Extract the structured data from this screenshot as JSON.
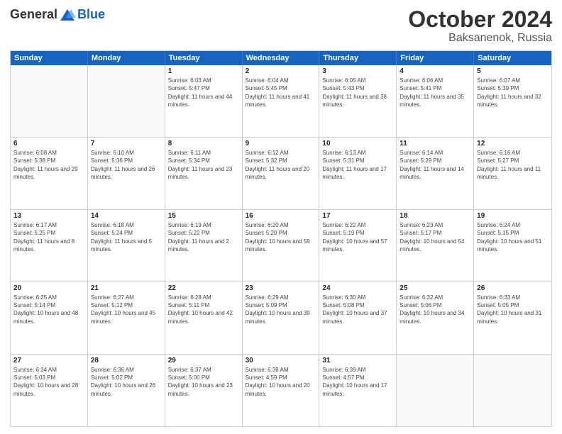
{
  "header": {
    "logo": {
      "general": "General",
      "blue": "Blue"
    },
    "month": "October 2024",
    "location": "Baksanenok, Russia"
  },
  "weekdays": [
    "Sunday",
    "Monday",
    "Tuesday",
    "Wednesday",
    "Thursday",
    "Friday",
    "Saturday"
  ],
  "rows": [
    [
      {
        "day": "",
        "sunrise": "",
        "sunset": "",
        "daylight": "",
        "empty": true
      },
      {
        "day": "",
        "sunrise": "",
        "sunset": "",
        "daylight": "",
        "empty": true
      },
      {
        "day": "1",
        "sunrise": "Sunrise: 6:03 AM",
        "sunset": "Sunset: 5:47 PM",
        "daylight": "Daylight: 11 hours and 44 minutes."
      },
      {
        "day": "2",
        "sunrise": "Sunrise: 6:04 AM",
        "sunset": "Sunset: 5:45 PM",
        "daylight": "Daylight: 11 hours and 41 minutes."
      },
      {
        "day": "3",
        "sunrise": "Sunrise: 6:05 AM",
        "sunset": "Sunset: 5:43 PM",
        "daylight": "Daylight: 11 hours and 38 minutes."
      },
      {
        "day": "4",
        "sunrise": "Sunrise: 6:06 AM",
        "sunset": "Sunset: 5:41 PM",
        "daylight": "Daylight: 11 hours and 35 minutes."
      },
      {
        "day": "5",
        "sunrise": "Sunrise: 6:07 AM",
        "sunset": "Sunset: 5:39 PM",
        "daylight": "Daylight: 11 hours and 32 minutes."
      }
    ],
    [
      {
        "day": "6",
        "sunrise": "Sunrise: 6:08 AM",
        "sunset": "Sunset: 5:38 PM",
        "daylight": "Daylight: 11 hours and 29 minutes."
      },
      {
        "day": "7",
        "sunrise": "Sunrise: 6:10 AM",
        "sunset": "Sunset: 5:36 PM",
        "daylight": "Daylight: 11 hours and 26 minutes."
      },
      {
        "day": "8",
        "sunrise": "Sunrise: 6:11 AM",
        "sunset": "Sunset: 5:34 PM",
        "daylight": "Daylight: 11 hours and 23 minutes."
      },
      {
        "day": "9",
        "sunrise": "Sunrise: 6:12 AM",
        "sunset": "Sunset: 5:32 PM",
        "daylight": "Daylight: 11 hours and 20 minutes."
      },
      {
        "day": "10",
        "sunrise": "Sunrise: 6:13 AM",
        "sunset": "Sunset: 5:31 PM",
        "daylight": "Daylight: 11 hours and 17 minutes."
      },
      {
        "day": "11",
        "sunrise": "Sunrise: 6:14 AM",
        "sunset": "Sunset: 5:29 PM",
        "daylight": "Daylight: 11 hours and 14 minutes."
      },
      {
        "day": "12",
        "sunrise": "Sunrise: 6:16 AM",
        "sunset": "Sunset: 5:27 PM",
        "daylight": "Daylight: 11 hours and 11 minutes."
      }
    ],
    [
      {
        "day": "13",
        "sunrise": "Sunrise: 6:17 AM",
        "sunset": "Sunset: 5:25 PM",
        "daylight": "Daylight: 11 hours and 8 minutes."
      },
      {
        "day": "14",
        "sunrise": "Sunrise: 6:18 AM",
        "sunset": "Sunset: 5:24 PM",
        "daylight": "Daylight: 11 hours and 5 minutes."
      },
      {
        "day": "15",
        "sunrise": "Sunrise: 6:19 AM",
        "sunset": "Sunset: 5:22 PM",
        "daylight": "Daylight: 11 hours and 2 minutes."
      },
      {
        "day": "16",
        "sunrise": "Sunrise: 6:20 AM",
        "sunset": "Sunset: 5:20 PM",
        "daylight": "Daylight: 10 hours and 59 minutes."
      },
      {
        "day": "17",
        "sunrise": "Sunrise: 6:22 AM",
        "sunset": "Sunset: 5:19 PM",
        "daylight": "Daylight: 10 hours and 57 minutes."
      },
      {
        "day": "18",
        "sunrise": "Sunrise: 6:23 AM",
        "sunset": "Sunset: 5:17 PM",
        "daylight": "Daylight: 10 hours and 54 minutes."
      },
      {
        "day": "19",
        "sunrise": "Sunrise: 6:24 AM",
        "sunset": "Sunset: 5:15 PM",
        "daylight": "Daylight: 10 hours and 51 minutes."
      }
    ],
    [
      {
        "day": "20",
        "sunrise": "Sunrise: 6:25 AM",
        "sunset": "Sunset: 5:14 PM",
        "daylight": "Daylight: 10 hours and 48 minutes."
      },
      {
        "day": "21",
        "sunrise": "Sunrise: 6:27 AM",
        "sunset": "Sunset: 5:12 PM",
        "daylight": "Daylight: 10 hours and 45 minutes."
      },
      {
        "day": "22",
        "sunrise": "Sunrise: 6:28 AM",
        "sunset": "Sunset: 5:11 PM",
        "daylight": "Daylight: 10 hours and 42 minutes."
      },
      {
        "day": "23",
        "sunrise": "Sunrise: 6:29 AM",
        "sunset": "Sunset: 5:09 PM",
        "daylight": "Daylight: 10 hours and 39 minutes."
      },
      {
        "day": "24",
        "sunrise": "Sunrise: 6:30 AM",
        "sunset": "Sunset: 5:08 PM",
        "daylight": "Daylight: 10 hours and 37 minutes."
      },
      {
        "day": "25",
        "sunrise": "Sunrise: 6:32 AM",
        "sunset": "Sunset: 5:06 PM",
        "daylight": "Daylight: 10 hours and 34 minutes."
      },
      {
        "day": "26",
        "sunrise": "Sunrise: 6:33 AM",
        "sunset": "Sunset: 5:05 PM",
        "daylight": "Daylight: 10 hours and 31 minutes."
      }
    ],
    [
      {
        "day": "27",
        "sunrise": "Sunrise: 6:34 AM",
        "sunset": "Sunset: 5:03 PM",
        "daylight": "Daylight: 10 hours and 28 minutes."
      },
      {
        "day": "28",
        "sunrise": "Sunrise: 6:36 AM",
        "sunset": "Sunset: 5:02 PM",
        "daylight": "Daylight: 10 hours and 26 minutes."
      },
      {
        "day": "29",
        "sunrise": "Sunrise: 6:37 AM",
        "sunset": "Sunset: 5:00 PM",
        "daylight": "Daylight: 10 hours and 23 minutes."
      },
      {
        "day": "30",
        "sunrise": "Sunrise: 6:38 AM",
        "sunset": "Sunset: 4:59 PM",
        "daylight": "Daylight: 10 hours and 20 minutes."
      },
      {
        "day": "31",
        "sunrise": "Sunrise: 6:39 AM",
        "sunset": "Sunset: 4:57 PM",
        "daylight": "Daylight: 10 hours and 17 minutes."
      },
      {
        "day": "",
        "sunrise": "",
        "sunset": "",
        "daylight": "",
        "empty": true
      },
      {
        "day": "",
        "sunrise": "",
        "sunset": "",
        "daylight": "",
        "empty": true
      }
    ]
  ]
}
